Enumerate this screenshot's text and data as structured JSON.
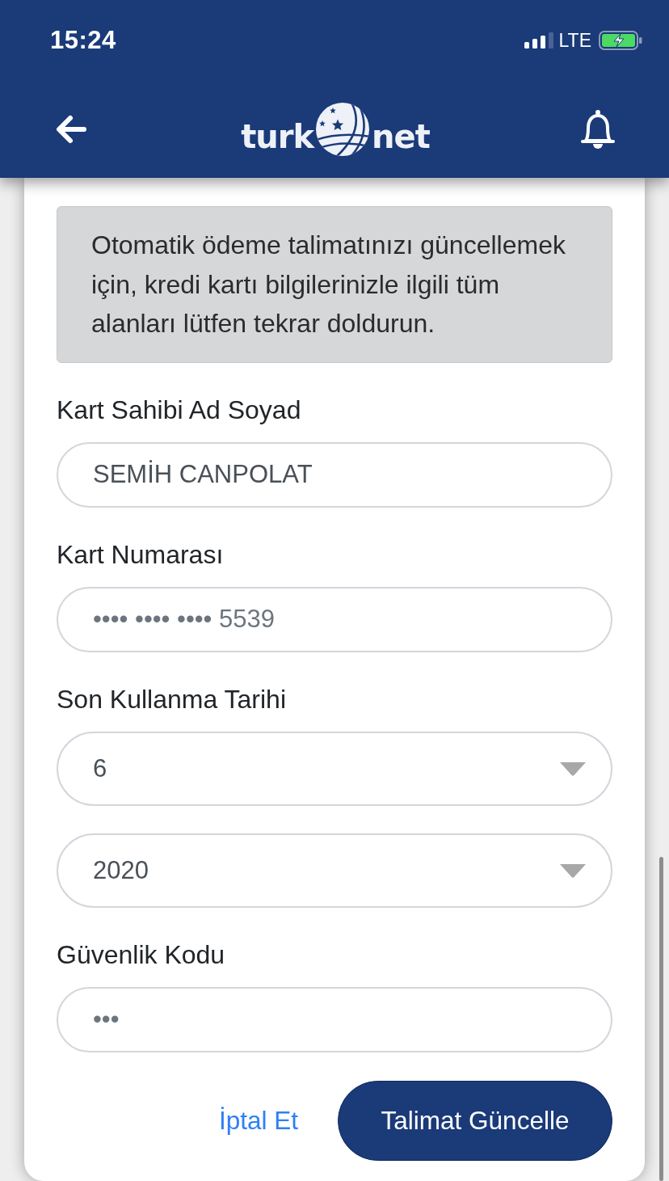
{
  "status_bar": {
    "time": "15:24",
    "network": "LTE"
  },
  "header": {
    "logo": [
      "turk",
      "net"
    ]
  },
  "notice": "Otomatik ödeme talimatınızı güncellemek için, kredi kartı bilgilerinizle ilgili tüm alanları lütfen tekrar doldurun.",
  "fields": [
    {
      "label": "Kart Sahibi Ad Soyad",
      "controls": [
        {
          "kind": "input",
          "value": "SEMİH CANPOLAT"
        }
      ]
    },
    {
      "label": "Kart Numarası",
      "controls": [
        {
          "kind": "input",
          "placeholder": "•••• •••• •••• 5539"
        }
      ]
    },
    {
      "label": "Son Kullanma Tarihi",
      "controls": [
        {
          "kind": "select",
          "value": "6"
        },
        {
          "kind": "select",
          "value": "2020"
        }
      ]
    },
    {
      "label": "Güvenlik Kodu",
      "controls": [
        {
          "kind": "input",
          "placeholder": "•••"
        }
      ]
    }
  ],
  "actions": [
    {
      "kind": "link",
      "label": "İptal Et"
    },
    {
      "kind": "primary",
      "label": "Talimat Güncelle"
    }
  ]
}
